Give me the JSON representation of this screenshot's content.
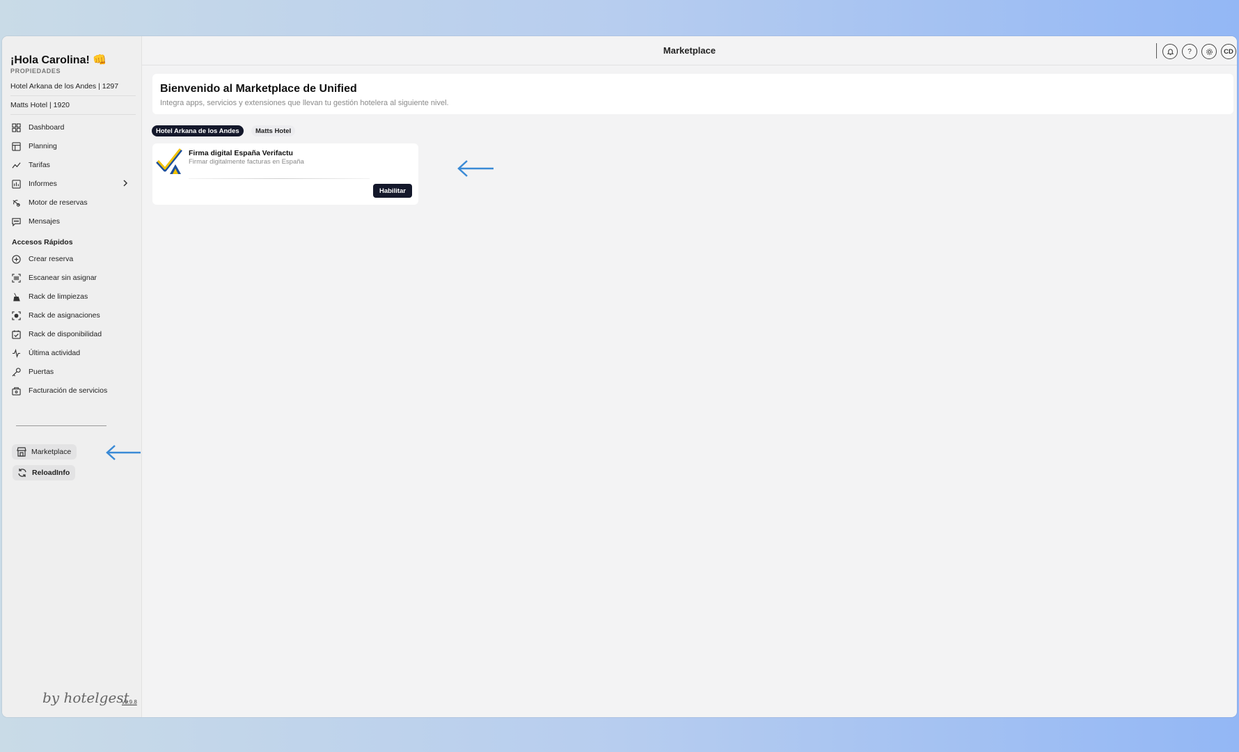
{
  "sidebar": {
    "greeting": "¡Hola Carolina!",
    "greeting_emoji": "👊",
    "properties_label": "PROPIEDADES",
    "hotels": [
      "Hotel Arkana de los Andes | 1297",
      "Matts Hotel | 1920"
    ],
    "nav": [
      {
        "label": "Dashboard",
        "icon": "grid-icon"
      },
      {
        "label": "Planning",
        "icon": "calendar-grid-icon"
      },
      {
        "label": "Tarifas",
        "icon": "trend-line-icon"
      },
      {
        "label": "Informes",
        "icon": "report-icon"
      },
      {
        "label": "Motor de reservas",
        "icon": "booking-engine-icon"
      },
      {
        "label": "Mensajes",
        "icon": "message-icon"
      }
    ],
    "quick_access_title": "Accesos Rápidos",
    "quick": [
      {
        "label": "Crear reserva",
        "icon": "plus-circle-icon"
      },
      {
        "label": "Escanear sin asignar",
        "icon": "barcode-icon"
      },
      {
        "label": "Rack de limpiezas",
        "icon": "broom-icon"
      },
      {
        "label": "Rack de asignaciones",
        "icon": "focus-icon"
      },
      {
        "label": "Rack de disponibilidad",
        "icon": "calendar-check-icon"
      },
      {
        "label": "Última actividad",
        "icon": "activity-icon"
      },
      {
        "label": "Puertas",
        "icon": "key-icon"
      },
      {
        "label": "Facturación de servicios",
        "icon": "bag-icon"
      }
    ],
    "marketplace_label": "Marketplace",
    "reload_label": "ReloadInfo",
    "brand": "by hotelgest",
    "version": "v3.9.8"
  },
  "topbar": {
    "title": "Marketplace",
    "initials": "CD"
  },
  "main": {
    "welcome_title": "Bienvenido al Marketplace de Unified",
    "welcome_subtitle": "Integra apps, servicios y extensiones que llevan tu gestión hotelera al siguiente nivel.",
    "tabs": [
      "Hotel Arkana de los Andes",
      "Matts Hotel"
    ],
    "apps": [
      {
        "name": "Firma digital España Verifactu",
        "description": "Firmar digitalmente facturas en España",
        "action": "Habilitar"
      }
    ]
  },
  "colors": {
    "accent_dark": "#14182b",
    "arrow_blue": "#3a8ad6",
    "logo_yellow": "#f2c200",
    "logo_blue": "#1d4f9c"
  }
}
